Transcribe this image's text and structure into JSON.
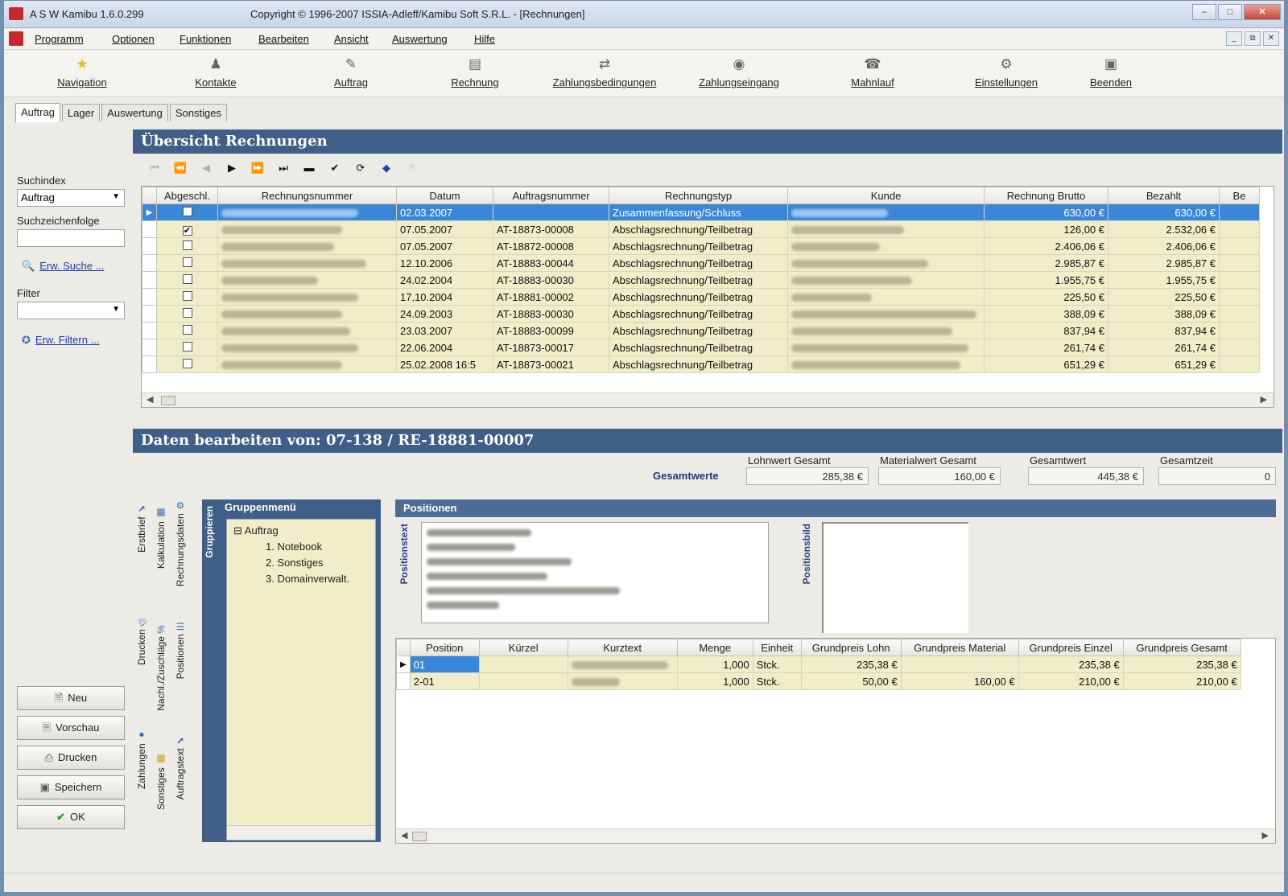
{
  "window": {
    "app_title": "A S W  Kamibu 1.6.0.299",
    "doc_title": "Copyright © 1996-2007 ISSIA-Adleff/Kamibu Soft S.R.L. - [Rechnungen]"
  },
  "menu": [
    "Programm",
    "Optionen",
    "Funktionen",
    "Bearbeiten",
    "Ansicht",
    "Auswertung",
    "Hilfe"
  ],
  "toolbar": [
    {
      "label": "Navigation",
      "icon": "star-icon"
    },
    {
      "label": "Kontakte",
      "icon": "contacts-icon"
    },
    {
      "label": "Auftrag",
      "icon": "order-icon"
    },
    {
      "label": "Rechnung",
      "icon": "invoice-icon"
    },
    {
      "label": "Zahlungsbedingungen",
      "icon": "payment-terms-icon"
    },
    {
      "label": "Zahlungseingang",
      "icon": "payment-in-icon"
    },
    {
      "label": "Mahnlauf",
      "icon": "reminder-icon"
    },
    {
      "label": "Einstellungen",
      "icon": "settings-icon"
    },
    {
      "label": "Beenden",
      "icon": "exit-icon"
    }
  ],
  "tabs": [
    "Auftrag",
    "Lager",
    "Auswertung",
    "Sonstiges"
  ],
  "left": {
    "suchindex_label": "Suchindex",
    "suchindex_value": "Auftrag",
    "suchfolge_label": "Suchzeichenfolge",
    "erw_suche": "Erw. Suche ...",
    "filter_label": "Filter",
    "filter_value": "",
    "erw_filtern": "Erw. Filtern ...",
    "buttons": {
      "neu": "Neu",
      "vorschau": "Vorschau",
      "drucken": "Drucken",
      "speichern": "Speichern",
      "ok": "OK"
    }
  },
  "overview": {
    "title": "Übersicht Rechnungen",
    "columns": [
      "Abgeschl.",
      "Rechnungsnummer",
      "Datum",
      "Auftragsnummer",
      "Rechnungstyp",
      "Kunde",
      "Rechnung Brutto",
      "Bezahlt",
      "Be"
    ],
    "rows": [
      {
        "checked": false,
        "datum": "02.03.2007",
        "auftrag": "",
        "typ": "Zusammenfassung/Schluss",
        "brutto": "630,00 €",
        "bezahlt": "630,00 €",
        "selected": true
      },
      {
        "checked": true,
        "datum": "07.05.2007",
        "auftrag": "AT-18873-00008",
        "typ": "Abschlagsrechnung/Teilbetrag",
        "brutto": "126,00 €",
        "bezahlt": "2.532,06 €",
        "selected": false
      },
      {
        "checked": false,
        "datum": "07.05.2007",
        "auftrag": "AT-18872-00008",
        "typ": "Abschlagsrechnung/Teilbetrag",
        "brutto": "2.406,06 €",
        "bezahlt": "2.406,06 €",
        "selected": false
      },
      {
        "checked": false,
        "datum": "12.10.2006",
        "auftrag": "AT-18883-00044",
        "typ": "Abschlagsrechnung/Teilbetrag",
        "brutto": "2.985,87 €",
        "bezahlt": "2.985,87 €",
        "selected": false
      },
      {
        "checked": false,
        "datum": "24.02.2004",
        "auftrag": "AT-18883-00030",
        "typ": "Abschlagsrechnung/Teilbetrag",
        "brutto": "1.955,75 €",
        "bezahlt": "1.955,75 €",
        "selected": false
      },
      {
        "checked": false,
        "datum": "17.10.2004",
        "auftrag": "AT-18881-00002",
        "typ": "Abschlagsrechnung/Teilbetrag",
        "brutto": "225,50 €",
        "bezahlt": "225,50 €",
        "selected": false
      },
      {
        "checked": false,
        "datum": "24.09.2003",
        "auftrag": "AT-18883-00030",
        "typ": "Abschlagsrechnung/Teilbetrag",
        "brutto": "388,09 €",
        "bezahlt": "388,09 €",
        "selected": false
      },
      {
        "checked": false,
        "datum": "23.03.2007",
        "auftrag": "AT-18883-00099",
        "typ": "Abschlagsrechnung/Teilbetrag",
        "brutto": "837,94 €",
        "bezahlt": "837,94 €",
        "selected": false
      },
      {
        "checked": false,
        "datum": "22.06.2004",
        "auftrag": "AT-18873-00017",
        "typ": "Abschlagsrechnung/Teilbetrag",
        "brutto": "261,74 €",
        "bezahlt": "261,74 €",
        "selected": false
      },
      {
        "checked": false,
        "datum": "25.02.2008 16:5",
        "auftrag": "AT-18873-00021",
        "typ": "Abschlagsrechnung/Teilbetrag",
        "brutto": "651,29 €",
        "bezahlt": "651,29 €",
        "selected": false
      }
    ]
  },
  "edit": {
    "title": "Daten bearbeiten von: 07-138 / RE-18881-00007",
    "gesamtwerte": "Gesamtwerte",
    "lohnwert_label": "Lohnwert Gesamt",
    "lohnwert": "285,38 €",
    "material_label": "Materialwert Gesamt",
    "material": "160,00 €",
    "gesamtwert_label": "Gesamtwert",
    "gesamtwert": "445,38 €",
    "gesamtzeit_label": "Gesamtzeit",
    "gesamtzeit": "0"
  },
  "vertical_tabs": [
    "Erstbrief",
    "Kalkulation",
    "Rechnungsdaten",
    "Drucken",
    "Nachl./Zuschläge",
    "Positionen",
    "Zahlungen",
    "Sonstiges",
    "Auftragstext"
  ],
  "gruppen": {
    "title": "Gruppenmenü",
    "vlabel": "Gruppieren",
    "tree": [
      "Auftrag",
      "1. Notebook",
      "2. Sonstiges",
      "3. Domainverwalt."
    ]
  },
  "positionen": {
    "title": "Positionen",
    "text_label": "Positionstext",
    "image_label": "Positionsbild",
    "columns": [
      "Position",
      "Kürzel",
      "Kurztext",
      "Menge",
      "Einheit",
      "Grundpreis Lohn",
      "Grundpreis Material",
      "Grundpreis Einzel",
      "Grundpreis Gesamt"
    ],
    "rows": [
      {
        "position": "01",
        "menge": "1,000",
        "einheit": "Stck.",
        "lohn": "235,38 €",
        "material": "",
        "einzel": "235,38 €",
        "gesamt": "235,38 €",
        "selected": true
      },
      {
        "position": "2-01",
        "menge": "1,000",
        "einheit": "Stck.",
        "lohn": "50,00 €",
        "material": "160,00 €",
        "einzel": "210,00 €",
        "gesamt": "210,00 €",
        "selected": false
      }
    ]
  }
}
